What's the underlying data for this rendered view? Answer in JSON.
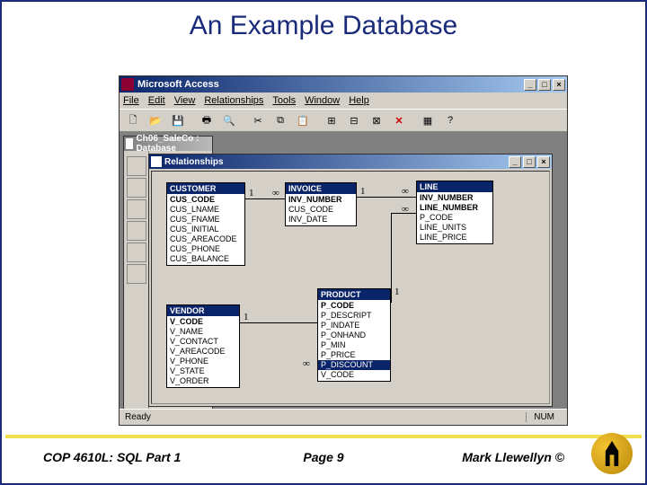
{
  "slide": {
    "title": "An Example Database"
  },
  "access": {
    "app_title": "Microsoft Access",
    "menus": [
      "File",
      "Edit",
      "View",
      "Relationships",
      "Tools",
      "Window",
      "Help"
    ],
    "db_win_title": "Ch06_SaleCo : Database",
    "rel_win_title": "Relationships",
    "status_left": "Ready",
    "status_right": "NUM"
  },
  "tables": {
    "customer": {
      "title": "CUSTOMER",
      "fields": [
        "CUS_CODE",
        "CUS_LNAME",
        "CUS_FNAME",
        "CUS_INITIAL",
        "CUS_AREACODE",
        "CUS_PHONE",
        "CUS_BALANCE"
      ]
    },
    "invoice": {
      "title": "INVOICE",
      "fields": [
        "INV_NUMBER",
        "CUS_CODE",
        "INV_DATE"
      ]
    },
    "line": {
      "title": "LINE",
      "fields": [
        "INV_NUMBER",
        "LINE_NUMBER",
        "P_CODE",
        "LINE_UNITS",
        "LINE_PRICE"
      ]
    },
    "vendor": {
      "title": "VENDOR",
      "fields": [
        "V_CODE",
        "V_NAME",
        "V_CONTACT",
        "V_AREACODE",
        "V_PHONE",
        "V_STATE",
        "V_ORDER"
      ]
    },
    "product": {
      "title": "PRODUCT",
      "fields": [
        "P_CODE",
        "P_DESCRIPT",
        "P_INDATE",
        "P_ONHAND",
        "P_MIN",
        "P_PRICE",
        "P_DISCOUNT",
        "V_CODE"
      ]
    }
  },
  "footer": {
    "left": "COP 4610L: SQL Part 1",
    "center": "Page 9",
    "right": "Mark Llewellyn ©"
  }
}
